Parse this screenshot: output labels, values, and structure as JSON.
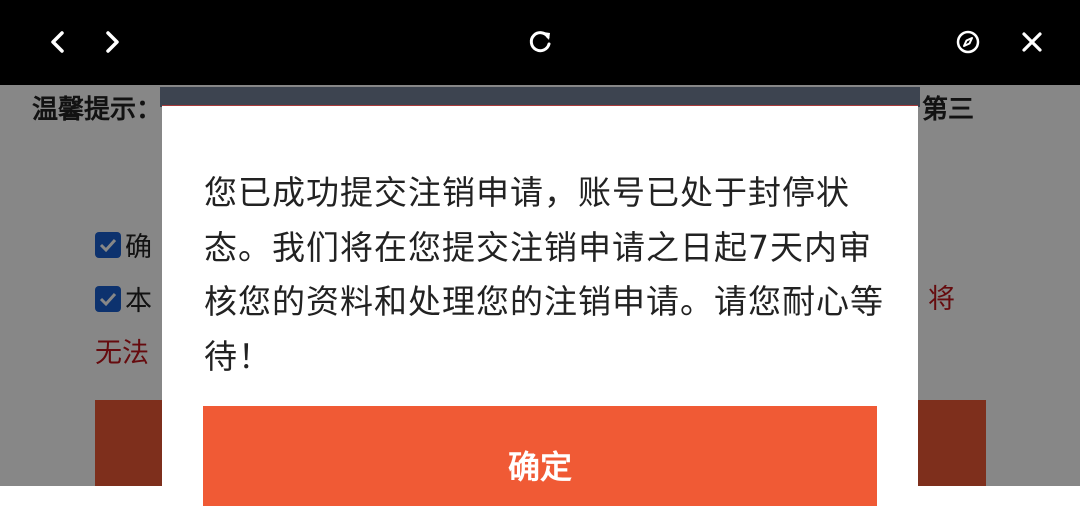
{
  "topbar": {
    "back_icon": "chevron-left-icon",
    "forward_icon": "chevron-right-icon",
    "refresh_icon": "refresh-icon",
    "browser_icon": "compass-icon",
    "close_icon": "close-icon"
  },
  "page": {
    "tip_title": "温馨提示：",
    "tip_tail": "第三",
    "check_rows": [
      {
        "label": "确"
      },
      {
        "label": "本"
      }
    ],
    "red_text_right": "将",
    "red_text_left": "无法"
  },
  "dialog": {
    "message": "您已成功提交注销申请，账号已处于封停状态。我们将在您提交注销申请之日起7天内审核您的资料和处理您的注销申请。请您耐心等待！",
    "confirm_label": "确定"
  },
  "colors": {
    "accent": "#f05a35",
    "checkbox": "#1a5fd0",
    "warning_text": "#c0151b"
  }
}
